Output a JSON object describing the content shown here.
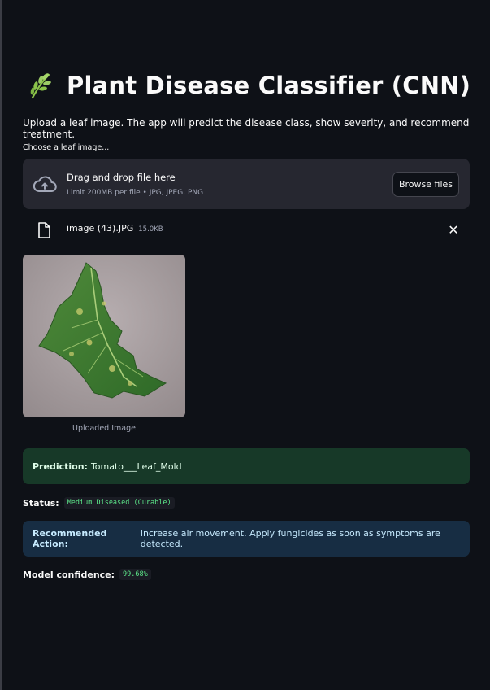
{
  "header": {
    "icon": "herb-icon",
    "title": "Plant Disease Classifier (CNN)",
    "description": "Upload a leaf image. The app will predict the disease class, show severity, and recommend treatment."
  },
  "uploader": {
    "label": "Choose a leaf image...",
    "drop_text": "Drag and drop file here",
    "limit_text": "Limit 200MB per file • JPG, JPEG, PNG",
    "browse_label": "Browse files",
    "file_name": "image (43).JPG",
    "file_size": "15.0KB",
    "remove_icon": "✕"
  },
  "image": {
    "caption": "Uploaded Image"
  },
  "prediction": {
    "label": "Prediction:",
    "value": "Tomato___Leaf_Mold"
  },
  "status": {
    "label": "Status:",
    "value": "Medium Diseased (Curable)"
  },
  "recommendation": {
    "label": "Recommended Action:",
    "value": "Increase air movement. Apply fungicides as soon as symptoms are detected."
  },
  "confidence": {
    "label": "Model confidence:",
    "value": "99.68%"
  },
  "colors": {
    "background": "#0e1117",
    "success_bg": "#173928",
    "info_bg": "#172d43",
    "code_green": "#5ce488"
  }
}
